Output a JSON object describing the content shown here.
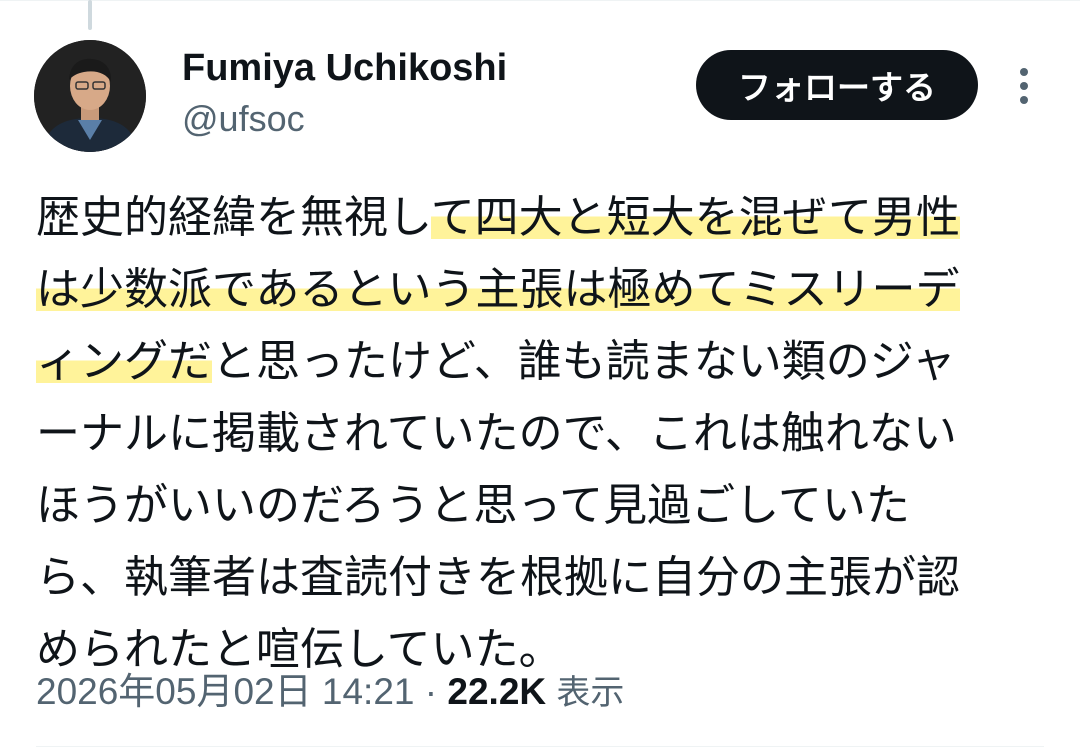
{
  "author": {
    "display_name": "Fumiya Uchikoshi",
    "handle": "@ufsoc"
  },
  "actions": {
    "follow_label": "フォローする",
    "more_icon": "more-vertical-icon"
  },
  "tweet": {
    "lines": [
      [
        {
          "t": "歴史的経緯を無視し",
          "hl": false
        },
        {
          "t": "て四大と短大を混ぜて男性",
          "hl": true
        }
      ],
      [
        {
          "t": "は少数派であるという主張は極めてミスリーデ",
          "hl": true
        }
      ],
      [
        {
          "t": "ィングだ",
          "hl": true
        },
        {
          "t": "と思ったけど、誰も読まない類のジャ",
          "hl": false
        }
      ],
      [
        {
          "t": "ーナルに掲載されていたので、これは触れない",
          "hl": false
        }
      ],
      [
        {
          "t": "ほうがいいのだろうと思って見過ごしていた",
          "hl": false
        }
      ],
      [
        {
          "t": "ら、執筆者は査読付きを根拠に自分の主張が認",
          "hl": false
        }
      ],
      [
        {
          "t": "められたと喧伝していた。",
          "hl": false
        }
      ]
    ],
    "highlight_color": "#fff39a"
  },
  "meta": {
    "timestamp": "2026年05月02日 14:21",
    "separator": "·",
    "views_count": "22.2K",
    "views_label": "表示"
  },
  "colors": {
    "text_primary": "#0f1419",
    "text_secondary": "#536471",
    "button_bg": "#0f1419"
  }
}
